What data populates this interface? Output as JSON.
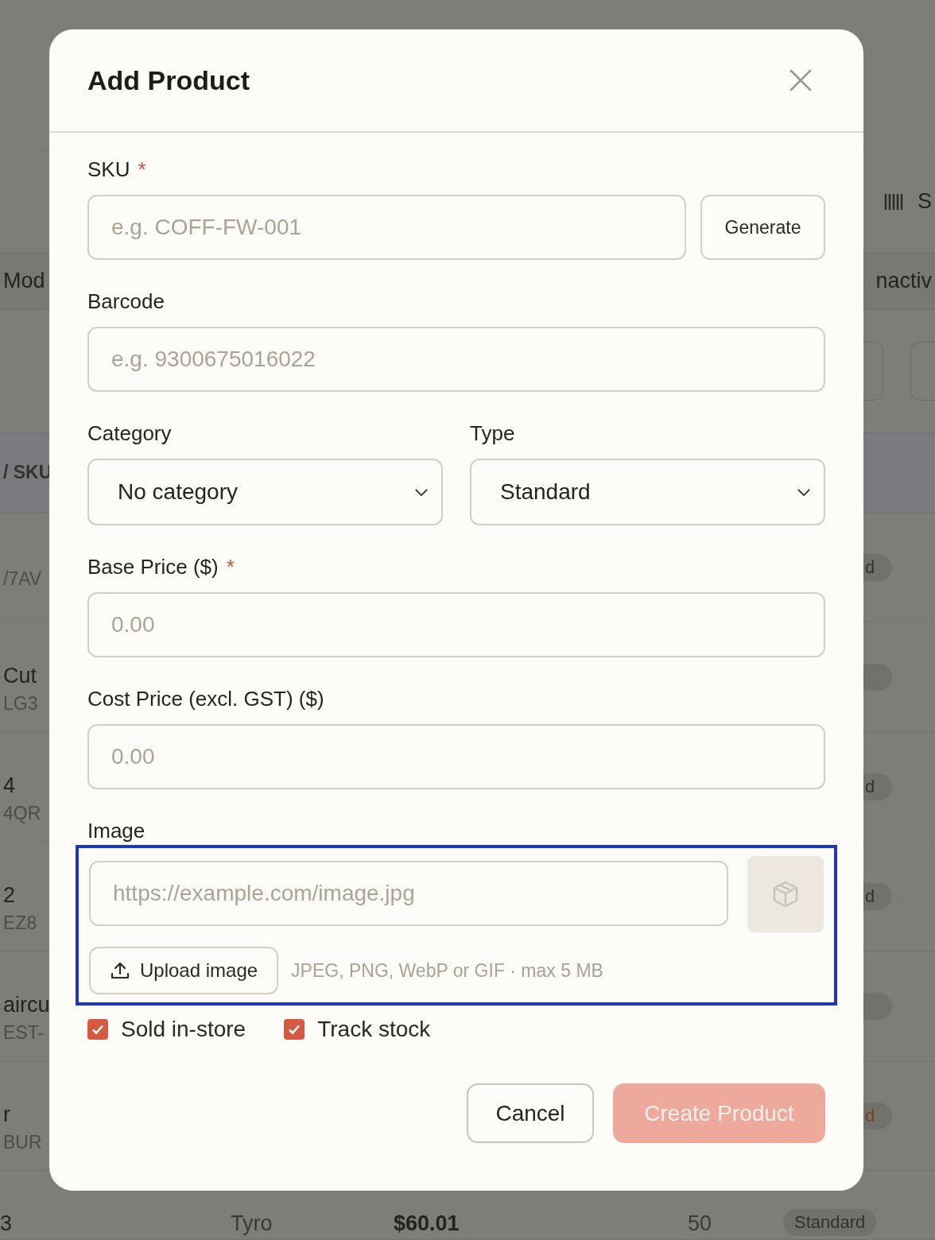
{
  "background": {
    "toolbar_label": "S",
    "filter_left": "Mod",
    "filter_right": "nactiv",
    "column_header": "/ SKU",
    "rows": [
      {
        "name": "",
        "sku": "/7AV",
        "badge": "d",
        "badge_accent": false
      },
      {
        "name": "Cut",
        "sku": "LG3"
      },
      {
        "name": "4",
        "sku": "4QR",
        "badge": "d",
        "badge_accent": false
      },
      {
        "name": "2",
        "sku": "EZ8",
        "badge": "d",
        "badge_accent": false
      },
      {
        "name": "aircu",
        "sku": "EST-"
      },
      {
        "name": "r",
        "sku": "BUR",
        "badge": "d",
        "badge_accent": true
      }
    ],
    "last_row": {
      "name": "3",
      "provider": "Tyro",
      "price": "$60.01",
      "stock": "50",
      "badge": "Standard",
      "badge_accent": false
    }
  },
  "dialog": {
    "title": "Add Product",
    "sku": {
      "label": "SKU",
      "required_mark": "*",
      "placeholder": "e.g. COFF-FW-001",
      "button": "Generate"
    },
    "barcode": {
      "label": "Barcode",
      "placeholder": "e.g. 9300675016022"
    },
    "selects": [
      {
        "label": "Category",
        "value": "No category"
      },
      {
        "label": "Type",
        "value": "Standard"
      }
    ],
    "base_price": {
      "label": "Base Price ($)",
      "required_mark": "*",
      "placeholder": "0.00"
    },
    "cost_price": {
      "label": "Cost Price (excl. GST) ($)",
      "placeholder": "0.00"
    },
    "image": {
      "label": "Image",
      "highlighted": true,
      "placeholder": "https://example.com/image.jpg",
      "upload_button": "Upload image",
      "hint": "JPEG, PNG, WebP or GIF · max 5 MB"
    },
    "checkboxes": [
      {
        "label": "Sold in-store",
        "checked": true
      },
      {
        "label": "Track stock",
        "checked": true
      }
    ],
    "cancel_button": "Cancel",
    "submit_button": {
      "label": "Create Product",
      "disabled": true
    }
  }
}
